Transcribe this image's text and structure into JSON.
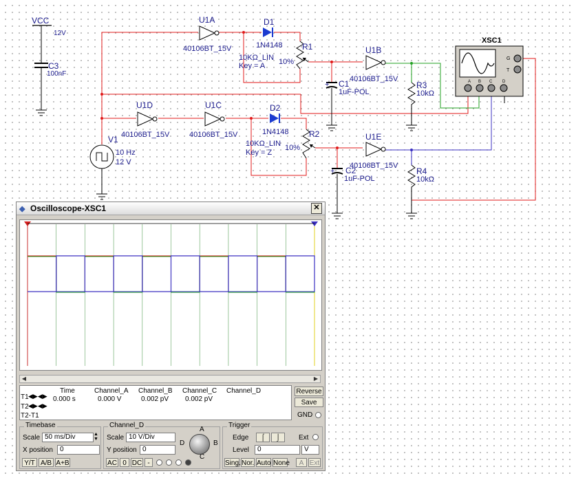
{
  "schematic": {
    "vcc": {
      "label": "VCC",
      "value": "12V"
    },
    "c3": {
      "ref": "C3",
      "value": "100nF"
    },
    "v1": {
      "ref": "V1",
      "freq": "10 Hz",
      "amp": "12 V"
    },
    "u1a": {
      "ref": "U1A",
      "part": "40106BT_15V"
    },
    "u1b": {
      "ref": "U1B",
      "part": "40106BT_15V"
    },
    "u1c": {
      "ref": "U1C",
      "part": "40106BT_15V"
    },
    "u1d": {
      "ref": "U1D",
      "part": "40106BT_15V"
    },
    "u1e": {
      "ref": "U1E",
      "part": "40106BT_15V"
    },
    "d1": {
      "ref": "D1",
      "part": "1N4148"
    },
    "d2": {
      "ref": "D2",
      "part": "1N4148"
    },
    "r1": {
      "ref": "R1",
      "value": "10KΩ_LIN",
      "key": "Key = A",
      "pct": "10%"
    },
    "r2": {
      "ref": "R2",
      "value": "10KΩ_LIN",
      "key": "Key = Z",
      "pct": "10%"
    },
    "r3": {
      "ref": "R3",
      "value": "10kΩ"
    },
    "r4": {
      "ref": "R4",
      "value": "10kΩ"
    },
    "c1": {
      "ref": "C1",
      "value": "1uF-POL"
    },
    "c2": {
      "ref": "C2",
      "value": "1uF-POL"
    },
    "xsc1": {
      "ref": "XSC1",
      "pins": [
        "A",
        "B",
        "C",
        "D"
      ],
      "g": "G",
      "t": "T"
    }
  },
  "oscilloscope": {
    "title": "Oscilloscope-XSC1",
    "close": "✕",
    "readout": {
      "headers": [
        "Time",
        "Channel_A",
        "Channel_B",
        "Channel_C",
        "Channel_D"
      ],
      "rows": [
        {
          "label": "T1",
          "values": [
            "0.000 s",
            "0.000 V",
            "0.002 pV",
            "0.002 pV",
            ""
          ]
        },
        {
          "label": "T2",
          "values": [
            "",
            "",
            "",
            "",
            ""
          ]
        },
        {
          "label": "T2-T1",
          "values": [
            "",
            "",
            "",
            "",
            ""
          ]
        }
      ]
    },
    "buttons": {
      "reverse": "Reverse",
      "save": "Save",
      "gnd": "GND"
    },
    "timebase": {
      "title": "Timebase",
      "scale_label": "Scale",
      "scale": "50 ms/Div",
      "xpos_label": "X position",
      "xpos": "0",
      "modes": [
        "Y/T",
        "A/B",
        "A+B"
      ]
    },
    "channel": {
      "title": "Channel_D",
      "scale_label": "Scale",
      "scale": "10  V/Div",
      "ypos_label": "Y position",
      "ypos": "0",
      "coupling": [
        "AC",
        "0",
        "DC",
        "-"
      ],
      "knob": {
        "a": "A",
        "b": "B",
        "c": "C",
        "d": "D"
      }
    },
    "trigger": {
      "title": "Trigger",
      "edge_label": "Edge",
      "ext_label": "Ext",
      "level_label": "Level",
      "level": "0",
      "level_unit": "V",
      "modes": [
        "Sing.",
        "Nor.",
        "Auto",
        "None"
      ],
      "src": [
        "A",
        "Ext"
      ]
    },
    "colors": {
      "ch_a": "#d42020",
      "ch_b": "#22a022",
      "ch_c": "#3a2fc0",
      "ch_d": "#303030",
      "cursor1": "#d42020",
      "cursor2": "#3a2fc0"
    }
  },
  "chart_data": {
    "type": "line",
    "x": [
      0,
      50,
      100,
      150,
      200,
      250,
      300,
      350,
      400,
      450,
      500
    ],
    "xlabel": "",
    "ylabel": "",
    "series": [
      {
        "values": [
          1,
          0,
          1,
          0,
          1,
          0,
          1,
          0,
          1,
          0,
          1
        ]
      },
      {
        "values": [
          0,
          1,
          0,
          1,
          0,
          1,
          0,
          1,
          0,
          1,
          0
        ]
      }
    ]
  }
}
